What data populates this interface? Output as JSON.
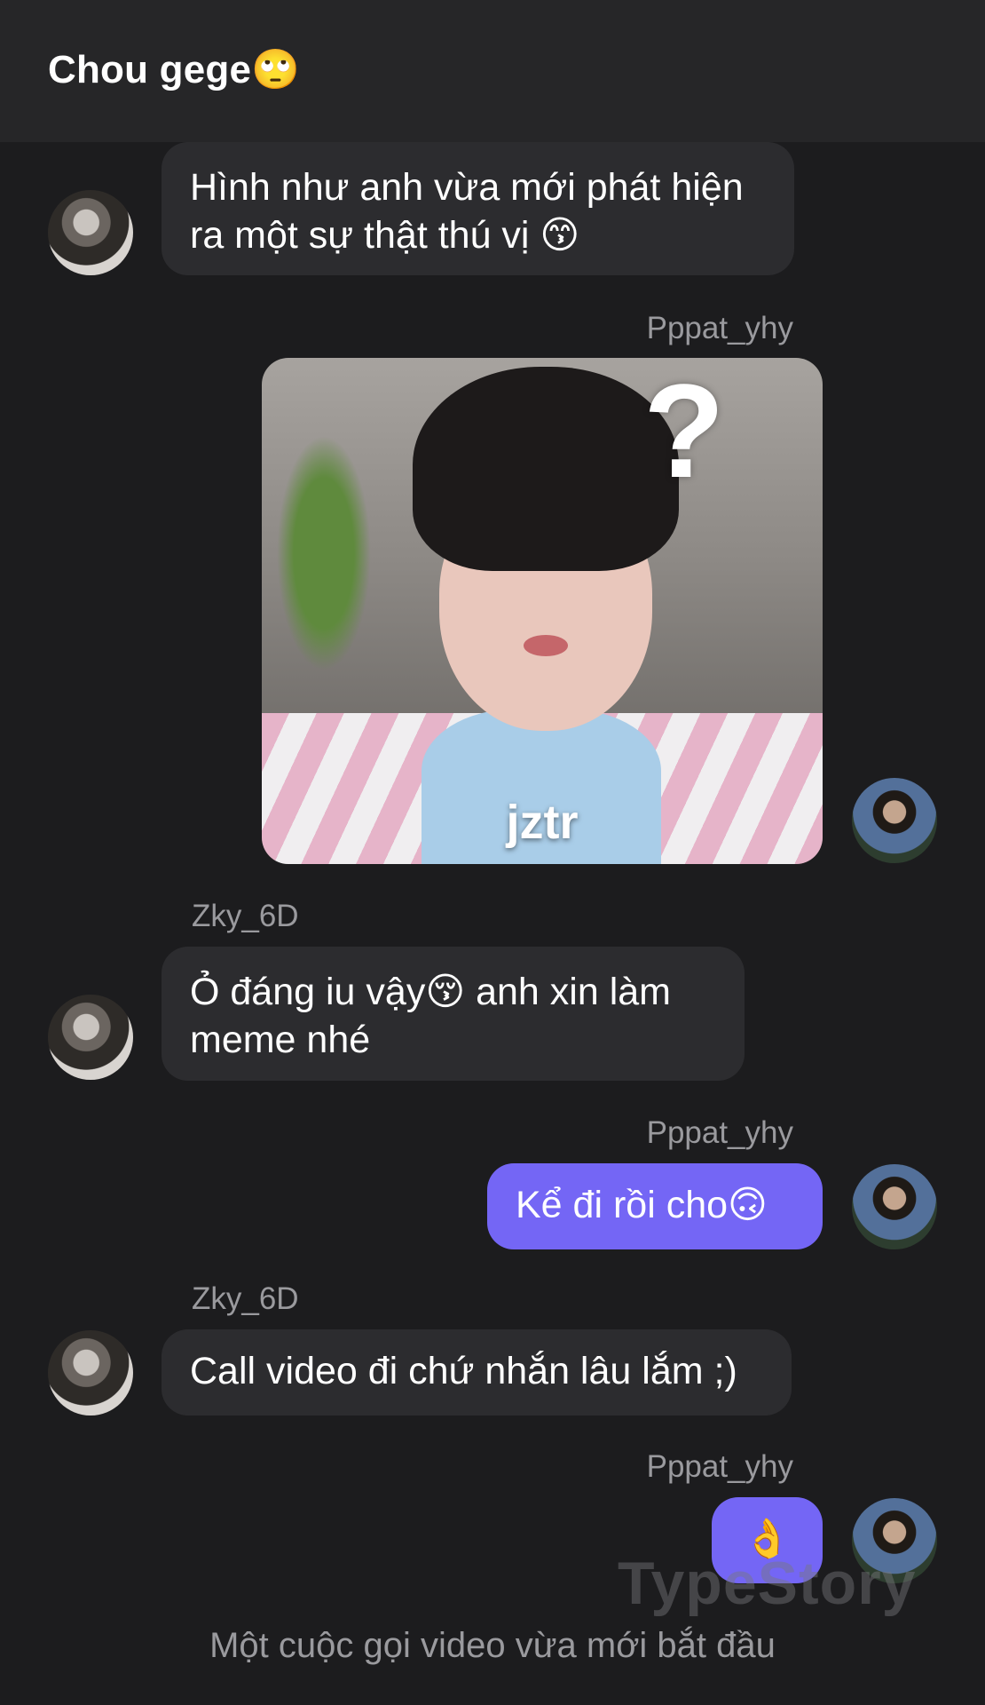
{
  "header": {
    "title": "Chou gege🙄"
  },
  "messages": [
    {
      "sender": "",
      "text": "Hình như anh vừa mới phát hiện ra một sự thật thú vị 😙"
    },
    {
      "sender": "Pppat_yhy",
      "image_caption": "jztr",
      "image_overlay": "?"
    },
    {
      "sender": "Zky_6D",
      "text": "Ỏ đáng iu vậy😚 anh xin làm meme nhé"
    },
    {
      "sender": "Pppat_yhy",
      "text": "Kể đi rồi cho🙃"
    },
    {
      "sender": "Zky_6D",
      "text": "Call video đi chứ nhắn lâu lắm ;)"
    },
    {
      "sender": "Pppat_yhy",
      "text": "👌"
    }
  ],
  "watermark": "TypeStory",
  "system_message": "Một cuộc gọi video vừa mới bắt đầu",
  "colors": {
    "background": "#1c1c1e",
    "header": "#262628",
    "incoming_bubble": "#2c2c2f",
    "outgoing_bubble": "#7466f5"
  }
}
